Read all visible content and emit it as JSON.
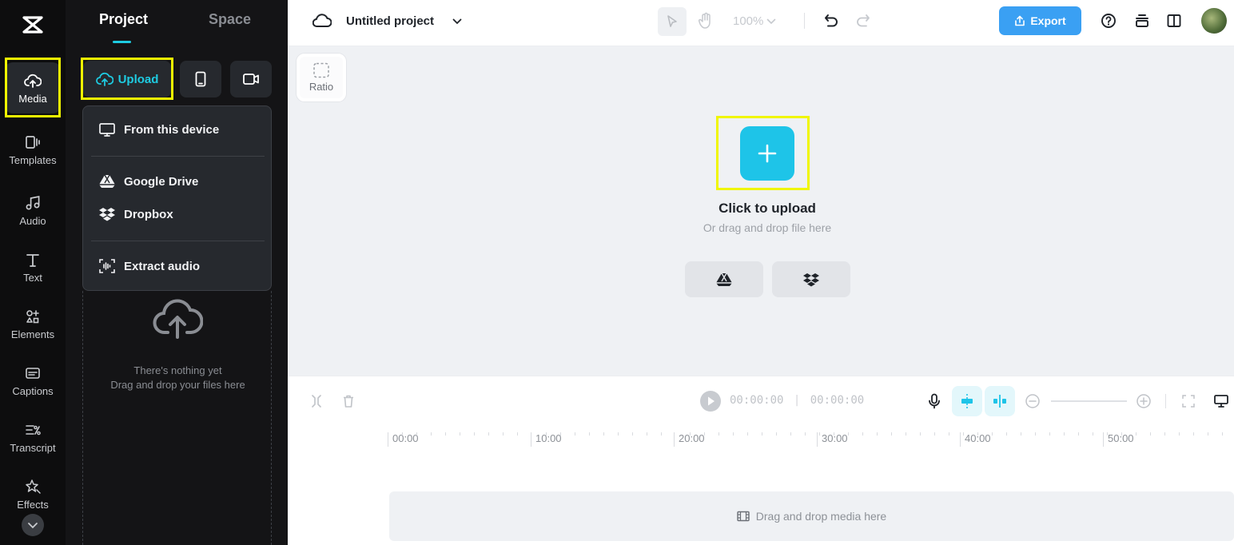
{
  "rail": {
    "items": [
      {
        "label": "Media",
        "icon": "cloud-upload-icon"
      },
      {
        "label": "Templates",
        "icon": "templates-icon"
      },
      {
        "label": "Audio",
        "icon": "music-note-icon"
      },
      {
        "label": "Text",
        "icon": "text-icon"
      },
      {
        "label": "Elements",
        "icon": "elements-icon"
      },
      {
        "label": "Captions",
        "icon": "captions-icon"
      },
      {
        "label": "Transcript",
        "icon": "transcript-icon"
      },
      {
        "label": "Effects",
        "icon": "effects-icon"
      }
    ],
    "active": "Media"
  },
  "panel": {
    "tabs": [
      "Project",
      "Space"
    ],
    "active_tab": "Project",
    "upload_label": "Upload",
    "menu": {
      "items": [
        "From this device",
        "Google Drive",
        "Dropbox",
        "Extract audio"
      ]
    },
    "empty": {
      "line1": "There's nothing yet",
      "line2": "Drag and drop your files here"
    }
  },
  "topbar": {
    "project_title": "Untitled project",
    "zoom": "100%",
    "export_label": "Export"
  },
  "canvas": {
    "ratio_label": "Ratio",
    "upload_title": "Click to upload",
    "upload_sub": "Or drag and drop file here"
  },
  "timeline": {
    "current_time": "00:00:00",
    "total_time": "00:00:00",
    "ruler_labels": [
      "00:00",
      "10:00",
      "20:00",
      "30:00",
      "40:00",
      "50:00"
    ],
    "drop_label": "Drag and drop media here"
  },
  "colors": {
    "accent": "#1ecbe1",
    "export": "#3aa0f3",
    "highlight": "#f0f600",
    "rail_bg": "#0d0d0e",
    "panel_bg": "#141416"
  }
}
